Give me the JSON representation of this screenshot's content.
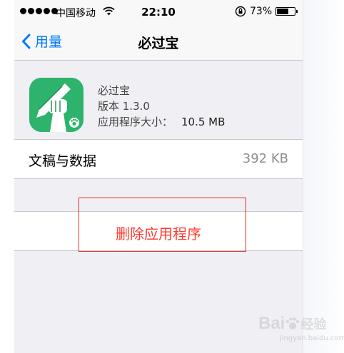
{
  "status_bar": {
    "carrier": "中国移动",
    "time": "22:10",
    "battery_percent": "73%",
    "battery_level": 0.73,
    "icons": [
      "signal-dots-icon",
      "wifi-icon",
      "rotation-lock-icon",
      "battery-icon"
    ]
  },
  "nav": {
    "back_label": "用量",
    "title": "必过宝"
  },
  "app": {
    "name": "必过宝",
    "version_label": "版本 1.3.0",
    "size_label": "应用程序大小：",
    "size_value": "10.5 MB",
    "icon": "fist-pencil-app-icon",
    "icon_color": "#2db36c"
  },
  "docs_row": {
    "label": "文稿与数据",
    "value": "392 KB"
  },
  "delete_row": {
    "label": "删除应用程序",
    "color": "#ff3b30"
  },
  "highlight_color": "#e0302a",
  "watermark": {
    "text": "Bai",
    "suffix": "经验",
    "sub": "jingyan.baidu.com"
  }
}
